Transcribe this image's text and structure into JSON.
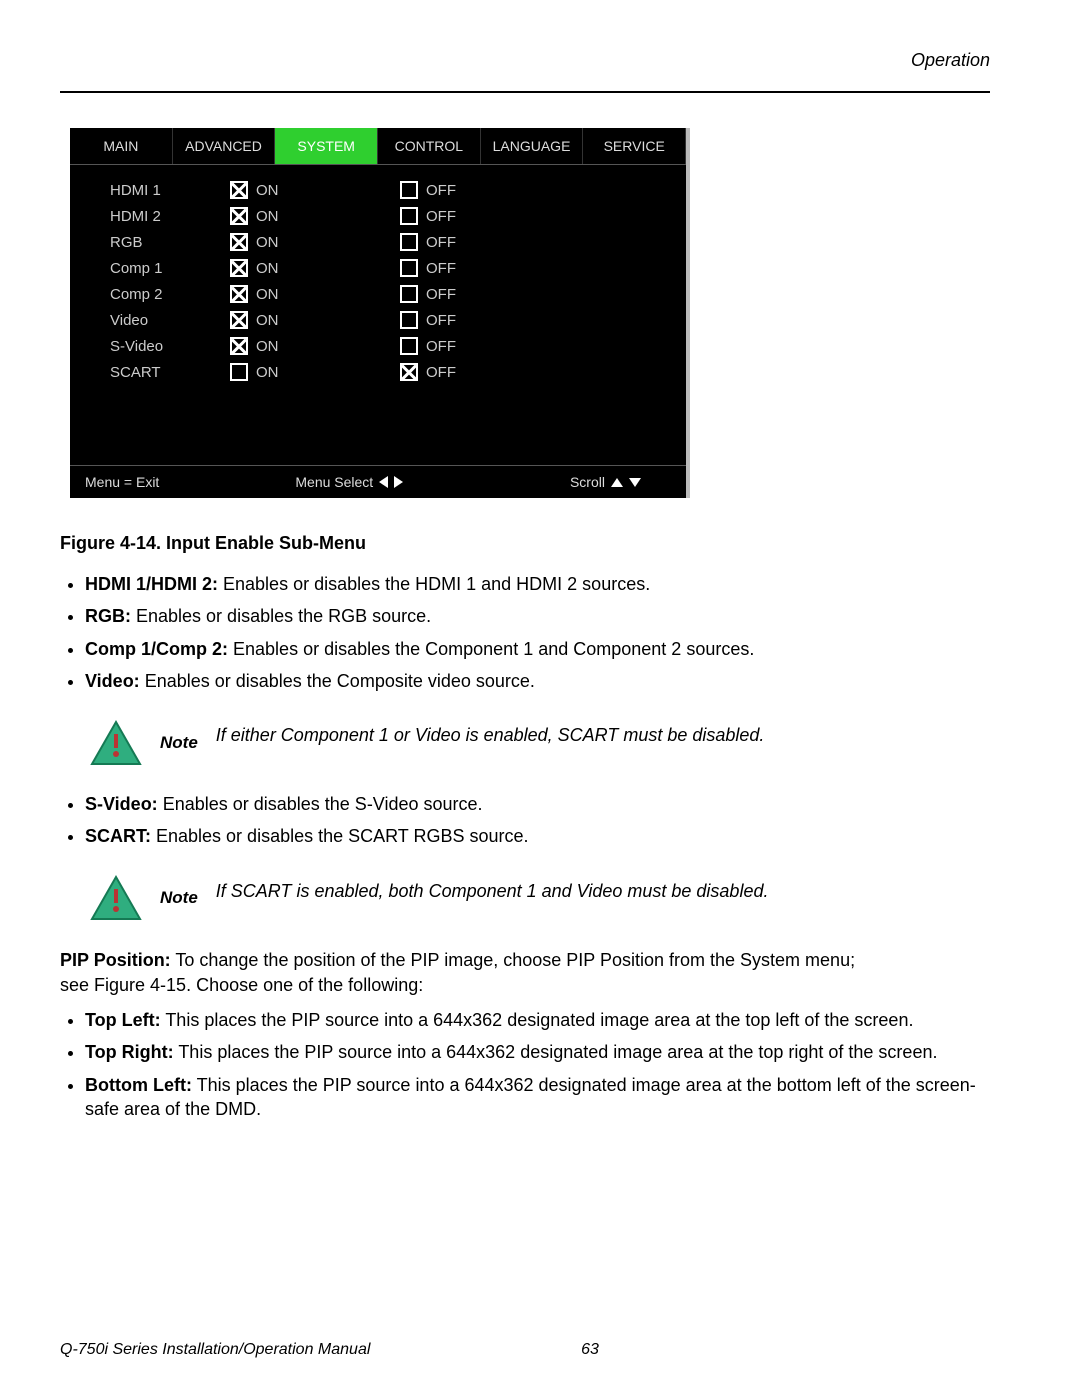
{
  "header": {
    "section": "Operation"
  },
  "osd": {
    "tabs": [
      "MAIN",
      "ADVANCED",
      "SYSTEM",
      "CONTROL",
      "LANGUAGE",
      "SERVICE"
    ],
    "active_tab_index": 2,
    "rows": [
      {
        "label": "HDMI 1",
        "on_checked": true,
        "on": "ON",
        "off_checked": false,
        "off": "OFF"
      },
      {
        "label": "HDMI 2",
        "on_checked": true,
        "on": "ON",
        "off_checked": false,
        "off": "OFF"
      },
      {
        "label": "RGB",
        "on_checked": true,
        "on": "ON",
        "off_checked": false,
        "off": "OFF"
      },
      {
        "label": "Comp 1",
        "on_checked": true,
        "on": "ON",
        "off_checked": false,
        "off": "OFF"
      },
      {
        "label": "Comp 2",
        "on_checked": true,
        "on": "ON",
        "off_checked": false,
        "off": "OFF"
      },
      {
        "label": "Video",
        "on_checked": true,
        "on": "ON",
        "off_checked": false,
        "off": "OFF"
      },
      {
        "label": "S-Video",
        "on_checked": true,
        "on": "ON",
        "off_checked": false,
        "off": "OFF"
      },
      {
        "label": "SCART",
        "on_checked": false,
        "on": "ON",
        "off_checked": true,
        "off": "OFF"
      }
    ],
    "footer": {
      "exit": "Menu = Exit",
      "select": "Menu Select",
      "scroll": "Scroll"
    }
  },
  "figure_caption": "Figure 4-14. Input Enable Sub-Menu",
  "bullets1": [
    {
      "b": "HDMI 1/HDMI 2:",
      "t": " Enables or disables the HDMI 1 and HDMI 2 sources."
    },
    {
      "b": "RGB:",
      "t": " Enables or disables the RGB source."
    },
    {
      "b": "Comp 1/Comp 2:",
      "t": " Enables or disables the Component 1 and Component 2 sources."
    },
    {
      "b": "Video:",
      "t": " Enables or disables the Composite video source."
    }
  ],
  "note1": {
    "label": "Note",
    "text": "If either Component 1 or Video is enabled, SCART must be disabled."
  },
  "bullets2": [
    {
      "b": "S-Video:",
      "t": " Enables or disables the S-Video source."
    },
    {
      "b": "SCART:",
      "t": " Enables or disables the SCART RGBS source."
    }
  ],
  "note2": {
    "label": "Note",
    "text": "If SCART is enabled, both Component 1 and Video must be disabled."
  },
  "pip_para": {
    "b": "PIP Position:",
    "t": " To change the position of the PIP image, choose PIP Position from the System menu; see Figure 4-15. Choose one of the following:"
  },
  "bullets3": [
    {
      "b": "Top Left:",
      "t": " This places the PIP source into a 644x362 designated image area at the top left of the screen."
    },
    {
      "b": "Top Right:",
      "t": " This places the PIP source into a 644x362 designated image area at the top right of the screen."
    },
    {
      "b": "Bottom Left:",
      "t": " This places the PIP source into a 644x362 designated image area at the bottom left of the screen-safe area of the DMD."
    }
  ],
  "footer": {
    "title": "Q-750i Series Installation/Operation Manual",
    "page": "63"
  }
}
